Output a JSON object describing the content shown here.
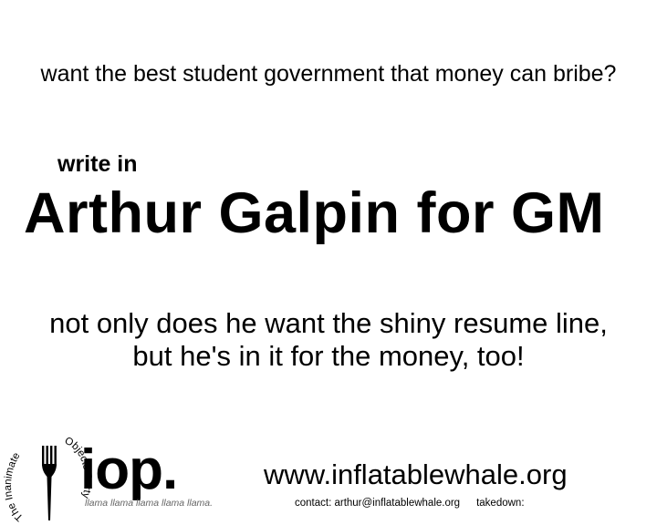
{
  "tagline": "want the best student government that money can bribe?",
  "write_in": "write in",
  "headline": "Arthur Galpin for GM",
  "pitch": {
    "line1": "not only does he want the shiny resume line,",
    "line2": "but he's in it for the money, too!"
  },
  "party": {
    "name_left": "The Inanimate",
    "name_right": "Objects Party",
    "abbrev": "iop.",
    "slogan": "llama llama llama llama llama.",
    "icon": "fork-icon"
  },
  "footer": {
    "website": "www.inflatablewhale.org",
    "contact": "contact: arthur@inflatablewhale.org",
    "takedown": "takedown:"
  },
  "colors": {
    "text": "#000000",
    "slogan": "#666666",
    "background": "#ffffff"
  }
}
